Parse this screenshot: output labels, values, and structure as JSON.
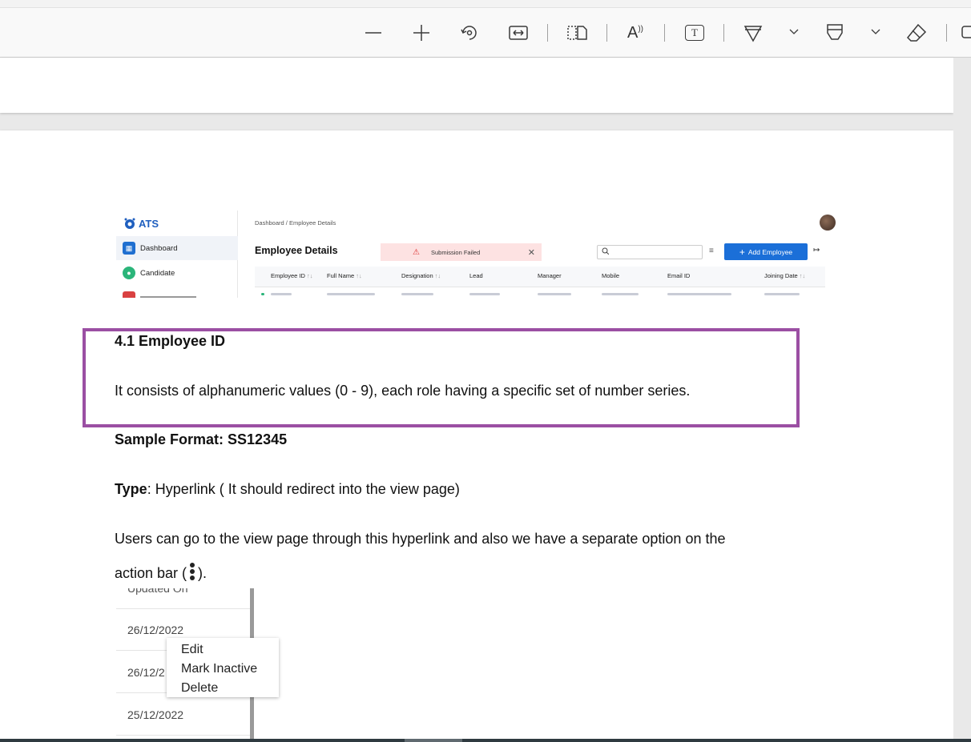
{
  "toolbar": {
    "buttons": [
      {
        "name": "zoom-out",
        "icon": "minus-icon"
      },
      {
        "name": "zoom-in",
        "icon": "plus-icon"
      },
      {
        "name": "rotate",
        "icon": "rotate-icon"
      },
      {
        "name": "fit-width",
        "icon": "fit-width-icon"
      },
      {
        "name": "page-view",
        "icon": "page-view-icon"
      },
      {
        "name": "read-aloud",
        "icon": "read-aloud-icon"
      },
      {
        "name": "text-box",
        "icon": "text-box-icon"
      },
      {
        "name": "draw",
        "icon": "draw-icon"
      },
      {
        "name": "highlight",
        "icon": "highlight-icon"
      },
      {
        "name": "erase",
        "icon": "eraser-icon"
      }
    ],
    "read_aloud_glyph": "A",
    "text_box_glyph": "T"
  },
  "ats": {
    "logo": "ATS",
    "breadcrumb": "Dashboard / Employee Details",
    "nav": [
      "Dashboard",
      "Candidate"
    ],
    "page_title": "Employee Details",
    "alert": "Submission Failed",
    "add_button": "Add Employee",
    "columns": [
      "Employee ID",
      "Full Name",
      "Designation",
      "Lead",
      "Manager",
      "Mobile",
      "Email ID",
      "Joining Date"
    ]
  },
  "doc": {
    "heading": "4.1 Employee ID",
    "description": "It consists  of alphanumeric values (0 - 9), each role having a specific set of number series.",
    "sample_format": "Sample Format: SS12345",
    "type_label": "Type",
    "type_text": ": Hyperlink ( It should redirect into the view page)",
    "users_line": "Users can go to the view page through this hyperlink and also we have a separate option on the",
    "action_bar_prefix": "action bar (",
    "action_bar_suffix": ")."
  },
  "snippet": {
    "header": "Updated On",
    "dates": [
      "26/12/2022",
      "26/12/2",
      "25/12/2022"
    ],
    "menu": [
      "Edit",
      "Mark Inactive",
      "Delete"
    ]
  },
  "colors": {
    "highlight_border": "#9b4fa3",
    "ats_primary": "#1b6fd8",
    "alert_bg": "#fde2e2"
  }
}
